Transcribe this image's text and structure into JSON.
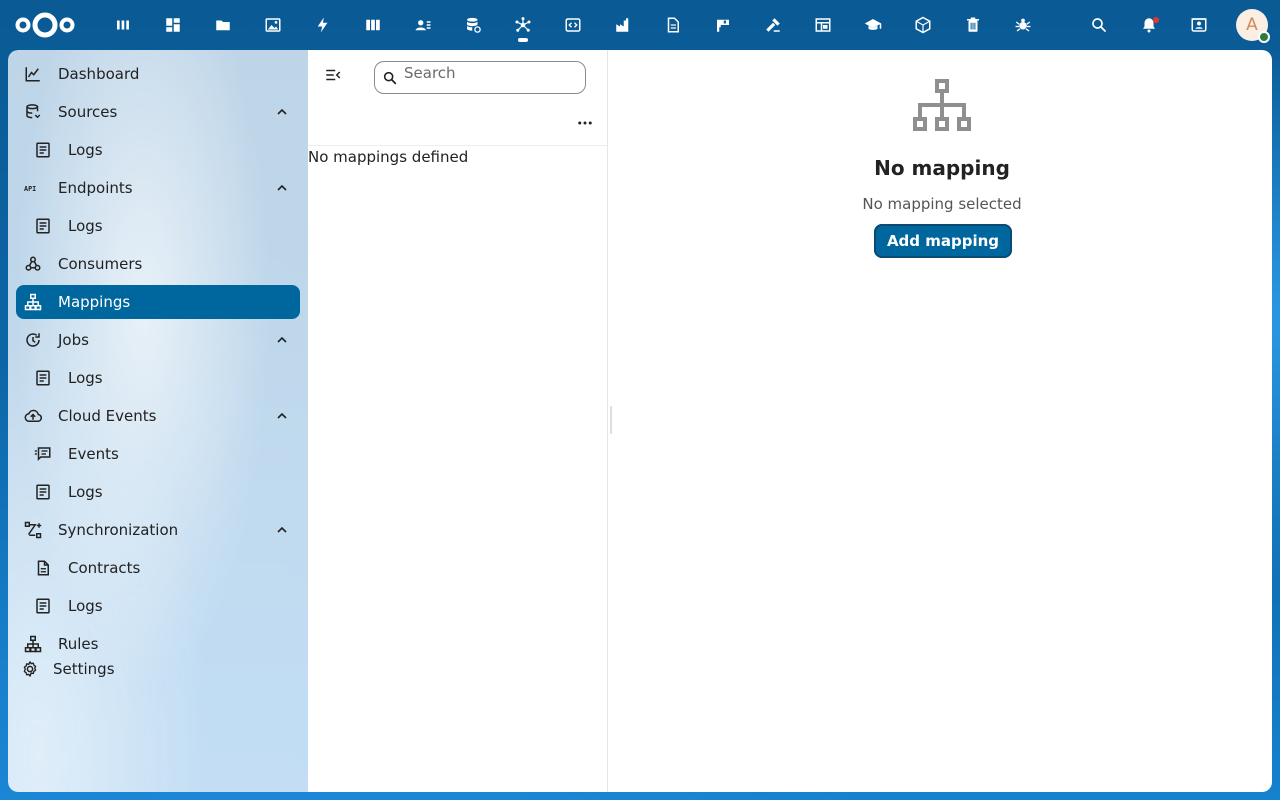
{
  "header": {
    "apps": [
      {
        "name": "dashboard-app-icon",
        "glyph": "bars"
      },
      {
        "name": "widgets-app-icon",
        "glyph": "grid"
      },
      {
        "name": "files-app-icon",
        "glyph": "folder"
      },
      {
        "name": "photos-app-icon",
        "glyph": "image"
      },
      {
        "name": "activity-app-icon",
        "glyph": "bolt"
      },
      {
        "name": "deck-app-icon",
        "glyph": "columns"
      },
      {
        "name": "contacts-app-icon",
        "glyph": "contacts"
      },
      {
        "name": "database-app-icon",
        "glyph": "db"
      },
      {
        "name": "openconnector-app-icon",
        "glyph": "hub",
        "active": true
      },
      {
        "name": "code-app-icon",
        "glyph": "code"
      },
      {
        "name": "factory-app-icon",
        "glyph": "factory"
      },
      {
        "name": "document-app-icon",
        "glyph": "doc"
      },
      {
        "name": "flag-app-icon",
        "glyph": "flag"
      },
      {
        "name": "gavel-app-icon",
        "glyph": "gavel"
      },
      {
        "name": "table-app-icon",
        "glyph": "table"
      },
      {
        "name": "education-app-icon",
        "glyph": "cap"
      },
      {
        "name": "package-app-icon",
        "glyph": "cube"
      },
      {
        "name": "trash-app-icon",
        "glyph": "trash"
      },
      {
        "name": "bug-app-icon",
        "glyph": "bug"
      }
    ],
    "avatar_initial": "A"
  },
  "nav": {
    "items": [
      {
        "label": "Dashboard",
        "icon": "chart-icon",
        "sub": false
      },
      {
        "label": "Sources",
        "icon": "database-icon",
        "sub": false,
        "expandable": true
      },
      {
        "label": "Logs",
        "icon": "log-icon",
        "sub": true
      },
      {
        "label": "Endpoints",
        "icon": "api-icon",
        "sub": false,
        "expandable": true
      },
      {
        "label": "Logs",
        "icon": "log-icon",
        "sub": true
      },
      {
        "label": "Consumers",
        "icon": "webhook-icon",
        "sub": false
      },
      {
        "label": "Mappings",
        "icon": "sitemap-icon",
        "sub": false,
        "active": true
      },
      {
        "label": "Jobs",
        "icon": "update-icon",
        "sub": false,
        "expandable": true
      },
      {
        "label": "Logs",
        "icon": "log-icon",
        "sub": true
      },
      {
        "label": "Cloud Events",
        "icon": "cloud-upload-icon",
        "sub": false,
        "expandable": true
      },
      {
        "label": "Events",
        "icon": "message-text-icon",
        "sub": true
      },
      {
        "label": "Logs",
        "icon": "log-icon",
        "sub": true
      },
      {
        "label": "Synchronization",
        "icon": "vector-polyline-icon",
        "sub": false,
        "expandable": true
      },
      {
        "label": "Contracts",
        "icon": "file-document-icon",
        "sub": true
      },
      {
        "label": "Logs",
        "icon": "log-icon",
        "sub": true
      },
      {
        "label": "Rules",
        "icon": "sitemap-icon",
        "sub": false
      }
    ],
    "settings_label": "Settings"
  },
  "list": {
    "search_placeholder": "Search",
    "empty_text": "No mappings defined"
  },
  "details": {
    "empty_title": "No mapping",
    "empty_subtitle": "No mapping selected",
    "add_button_label": "Add mapping"
  },
  "colors": {
    "primary": "#00679e",
    "header_bg": "#0b5f9a",
    "notification": "#e9322d",
    "status_online": "#2d7b41"
  }
}
